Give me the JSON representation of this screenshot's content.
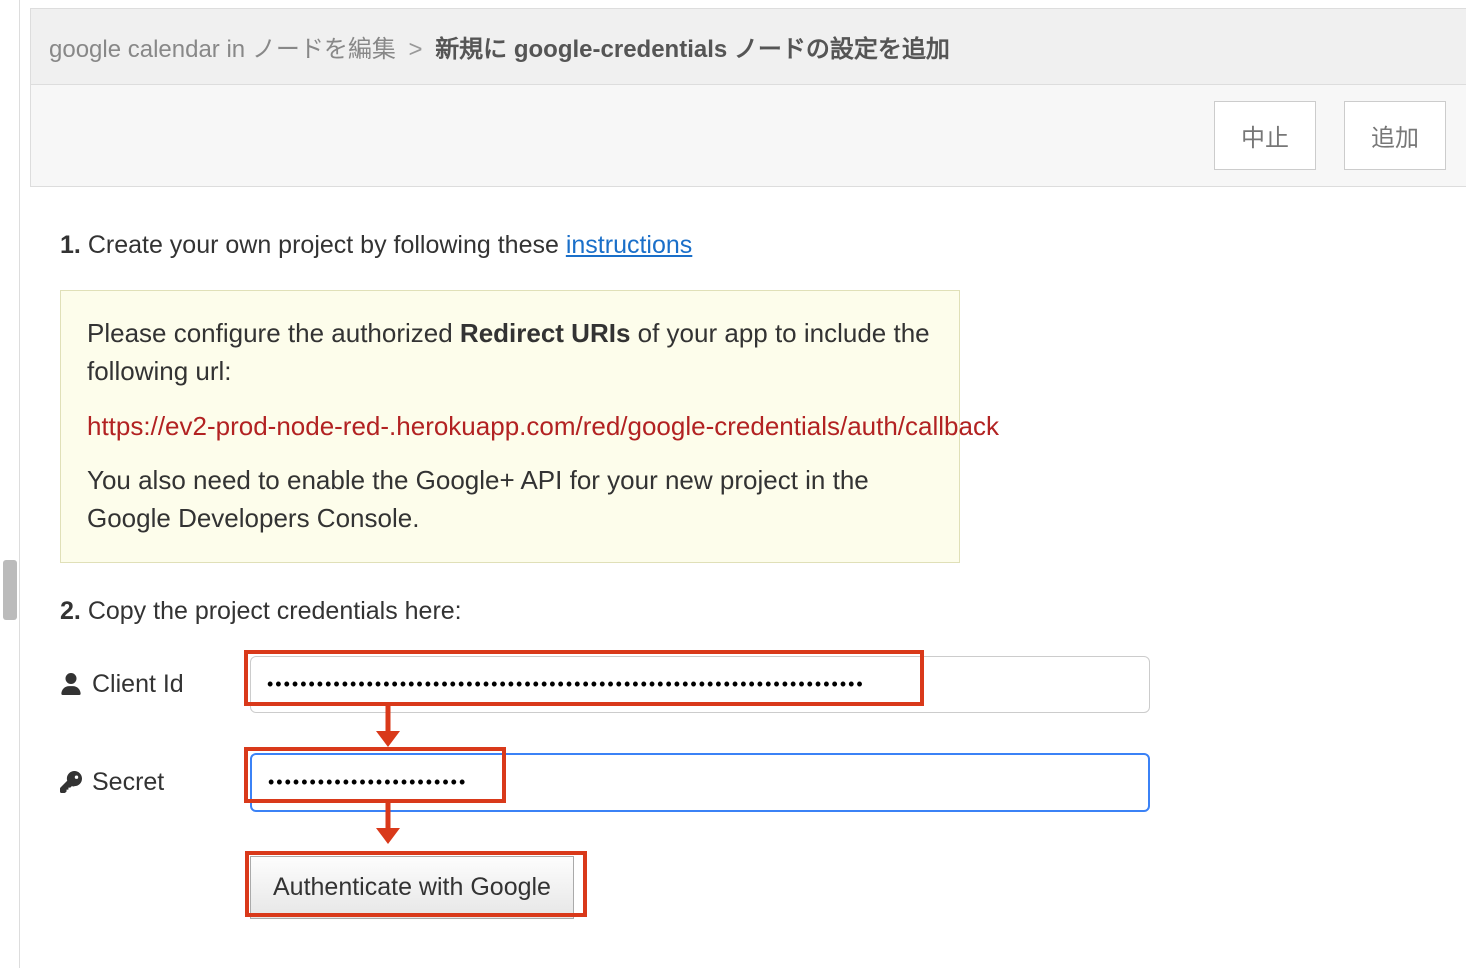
{
  "breadcrumb": {
    "parent": "google calendar in ノードを編集",
    "separator": ">",
    "current": "新規に google-credentials ノードの設定を追加"
  },
  "toolbar": {
    "cancel_label": "中止",
    "add_label": "追加"
  },
  "steps": {
    "s1": {
      "num": "1.",
      "text": "Create your own project by following these ",
      "link_text": "instructions"
    },
    "box": {
      "line1a": "Please configure the authorized ",
      "line1b": "Redirect URIs",
      "line1c": " of your app to include the following url:",
      "url_prefix": "https://ev2-prod-node-red-",
      "url_suffix": ".herokuapp.com/red/google-credentials/auth/callback",
      "line3": "You also need to enable the Google+ API for your new project in the Google Developers Console."
    },
    "s2": {
      "num": "2.",
      "text": "Copy the project credentials here:"
    }
  },
  "form": {
    "client_id_label": "Client Id",
    "client_id_value": "xxxxxxxxxxxxxxxxxxxxxxxxxxxxxxxxxxxxxxxxxxxxxxxxxxxxxxxxxxxxxxxxxxxxxxxx",
    "secret_label": "Secret",
    "secret_value": "xxxxxxxxxxxxxxxxxxxxxxxx",
    "auth_button": "Authenticate with Google"
  }
}
